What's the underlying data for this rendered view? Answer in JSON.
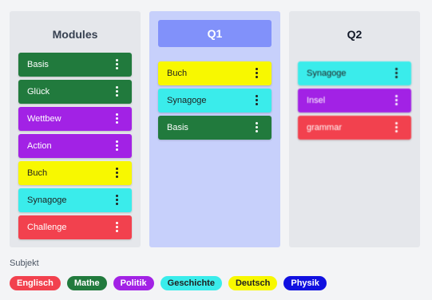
{
  "columns": {
    "modules": {
      "title": "Modules",
      "cards": [
        {
          "label": "Basis",
          "color": "#217a3d"
        },
        {
          "label": "Glück",
          "color": "#217a3d"
        },
        {
          "label": "Wettbew",
          "color": "#a222e5"
        },
        {
          "label": "Action",
          "color": "#a222e5"
        },
        {
          "label": "Buch",
          "color": "#f8f800"
        },
        {
          "label": "Synagoge",
          "color": "#3aeceb"
        },
        {
          "label": "Challenge",
          "color": "#f2414e"
        }
      ]
    },
    "q1": {
      "title": "Q1",
      "cards": [
        {
          "label": "Buch",
          "color": "#f8f800"
        },
        {
          "label": "Synagoge",
          "color": "#3aeceb"
        },
        {
          "label": "Basis",
          "color": "#217a3d"
        }
      ]
    },
    "q2": {
      "title": "Q2",
      "cards": [
        {
          "label": "Synagoge",
          "color": "#3aeceb"
        },
        {
          "label": "Insel",
          "color": "#a222e5"
        },
        {
          "label": "grammar",
          "color": "#f2414e"
        }
      ]
    }
  },
  "card_menu_icon": "vertical-dots-icon",
  "subjekt": {
    "label": "Subjekt",
    "tags": [
      {
        "label": "Englisch",
        "color": "#f2414e"
      },
      {
        "label": "Mathe",
        "color": "#217a3d"
      },
      {
        "label": "Politik",
        "color": "#a222e5"
      },
      {
        "label": "Geschichte",
        "color": "#3aeceb"
      },
      {
        "label": "Deutsch",
        "color": "#f8f800"
      },
      {
        "label": "Physik",
        "color": "#1010e0"
      }
    ]
  }
}
